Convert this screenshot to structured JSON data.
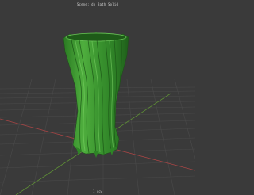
{
  "viewport": {
    "title": "Scene: do Bath Solid",
    "footer": "1 ccw"
  },
  "colors": {
    "background": "#3a3a3a",
    "grid_line": "#474747",
    "axis_x": "#b04848",
    "axis_y": "#6fa13f",
    "object": "#3f9b32",
    "object_light": "#63c04f",
    "object_dark": "#1f5d1a"
  },
  "icons": {
    "object": "green-vase-mesh"
  }
}
